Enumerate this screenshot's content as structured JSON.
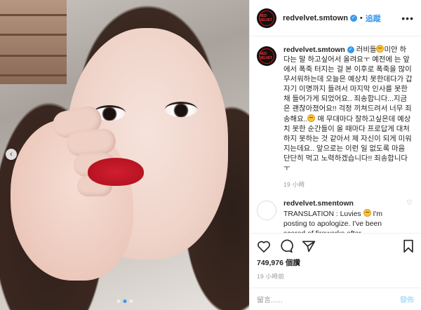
{
  "header": {
    "username": "redvelvet.smtown",
    "separator": "•",
    "follow_label": "追蹤",
    "more_label": "•••",
    "avatar_text": "RED VELVET"
  },
  "caption": {
    "author": "redvelvet.smtown",
    "text_before": "러비들",
    "text_1": "미안 하다는 말 하고싶어서 올려요ㅜ 예전에 는 앞에서 폭죽 터지는 걸 본 이후로 폭죽을 많이 무서워하는데 오늘은 예상치 못한데다가 갑자기 이명까지 들려서 마지막 인사를 못한채 들어가게 되었어요.. 죄송합니다...지금은 괜찮아졌어요!! 걱정 끼쳐드려서 너무 죄송해요..",
    "text_2": " 매 무대마다 잘하고싶은데 예상치 못한 순간들이 올 때마다 프로답게 대처하지 못하는 것 같아서 제 자신이 되게 미워지는데요.. 앞으로는 이런 일 없도록 마음 단단히 먹고 노력하겠습니다!! 죄송합니다ㅜ",
    "time": "19 小時"
  },
  "comment": {
    "author": "redvelvet.smentown",
    "text_1": "TRANSLATION : Luvies ",
    "text_2": " I'm posting to apologize. I've been scared of fireworks after"
  },
  "actions": {
    "likes": "749,976 個讚",
    "post_time": "19 小時前"
  },
  "add_comment": {
    "placeholder": "留言......",
    "post_label": "發佈"
  },
  "carousel": {
    "prev_arrow": "‹",
    "dots": 3,
    "active_dot": 1
  },
  "colors": {
    "accent": "#3897f0",
    "lips": "#c8172a"
  }
}
